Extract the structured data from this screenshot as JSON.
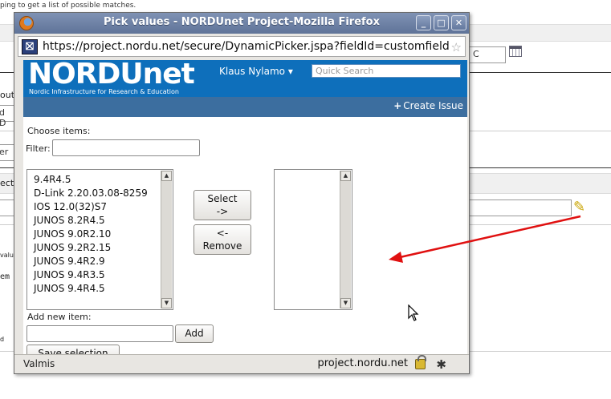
{
  "background": {
    "hint_text": "ping to get a list of possible matches.",
    "fragments": [
      "C",
      "outa",
      "d D",
      "er",
      "ecti",
      "valu",
      "em",
      "d"
    ]
  },
  "window": {
    "title": "Pick values - NORDUnet Project-Mozilla Firefox",
    "buttons": {
      "minimize": "_",
      "maximize": "□",
      "close": "✕"
    },
    "url": "https://project.nordu.net/secure/DynamicPicker.jspa?fieldId=customfield_10280"
  },
  "header": {
    "logo": "NORDUnet",
    "logo_subtitle": "Nordic Infrastructure for Research & Education",
    "user": "Klaus Nylamo",
    "user_caret": "▾",
    "search_placeholder": "Quick Search",
    "create_issue": "Create Issue",
    "create_plus": "+"
  },
  "picker": {
    "choose_label": "Choose items:",
    "filter_label": "Filter:",
    "filter_value": "",
    "available_items": [
      "9.4R4.5",
      "D-Link 2.20.03.08-8259",
      "IOS 12.0(32)S7",
      "JUNOS 8.2R4.5",
      "JUNOS 9.0R2.10",
      "JUNOS 9.2R2.15",
      "JUNOS 9.4R2.9",
      "JUNOS 9.4R3.5",
      "JUNOS 9.4R4.5"
    ],
    "selected_items": [],
    "select_button": {
      "line1": "Select",
      "line2": "->"
    },
    "remove_button": {
      "line1": "<-",
      "line2": "Remove"
    },
    "add_new_label": "Add new item:",
    "add_value": "",
    "add_button": "Add",
    "save_button": "Save selection"
  },
  "statusbar": {
    "left": "Valmis",
    "host": "project.nordu.net"
  },
  "colors": {
    "header_blue": "#0e6fbb",
    "create_bar": "#3c6e9f",
    "titlebar": "#6f83a8",
    "annotation_arrow": "#e01010"
  }
}
